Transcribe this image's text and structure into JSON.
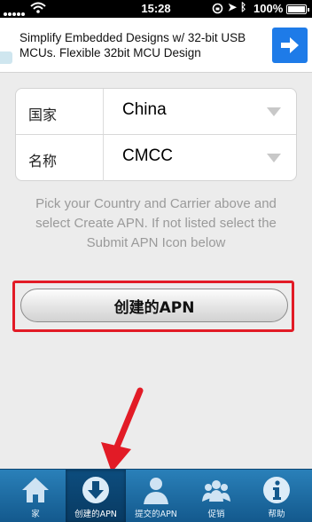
{
  "status_bar": {
    "time": "15:28",
    "battery_percent": "100%"
  },
  "ad": {
    "text": "Simplify Embedded Designs w/ 32-bit USB MCUs. Flexible 32bit MCU Design"
  },
  "form": {
    "country_label": "国家",
    "country_value": "China",
    "name_label": "名称",
    "name_value": "CMCC"
  },
  "helper_text": "Pick your Country and Carrier above and select Create APN. If not listed select the Submit APN Icon below",
  "create_button_label": "创建的APN",
  "tabs": [
    {
      "label": "家",
      "icon": "home-icon",
      "selected": false
    },
    {
      "label": "创建的APN",
      "icon": "download-icon",
      "selected": true
    },
    {
      "label": "提交的APN",
      "icon": "user-icon",
      "selected": false
    },
    {
      "label": "促销",
      "icon": "group-icon",
      "selected": false
    },
    {
      "label": "帮助",
      "icon": "info-icon",
      "selected": false
    }
  ],
  "colors": {
    "accent_blue": "#1e7be8",
    "tab_bar": "#1d6ea5",
    "highlight_red": "#e21b26"
  }
}
